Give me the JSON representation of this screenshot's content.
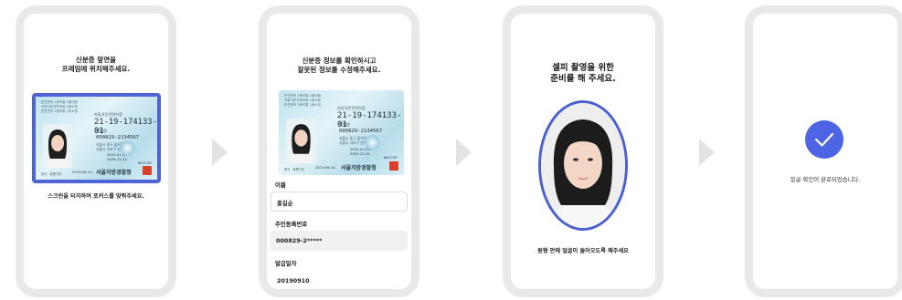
{
  "colors": {
    "accent": "#4d63d6",
    "frame": "#e9e9e9",
    "arrow": "#e3e3e3"
  },
  "screen1": {
    "title": "신분증 앞면을\n프레임에 위치해주세요.",
    "caption": "스크린을 터치하여 포커스를 맞춰주세요."
  },
  "screen2": {
    "title": "신분증 정보를 확인하시고\n잘못된 정보를 수정해주세요.",
    "fields": [
      {
        "label": "이름",
        "value": "홍길순"
      },
      {
        "label": "주민등록번호",
        "value": "000829-2*****"
      },
      {
        "label": "발급일자",
        "value": "20190910"
      }
    ]
  },
  "screen3": {
    "title": "셀피 촬영을 위한\n준비를 해 주세요.",
    "caption": "원형 안에 얼굴이 들어오도록 해주세요"
  },
  "screen4": {
    "message": "얼굴 확인이 완료되었습니다.",
    "icon": "check-icon"
  },
  "id_card": {
    "header": "운전면허 1종보통 1종대형\n자동차운전면허증 2종소형\n운전면허 2종보통 1종소형",
    "license_title": "자동차운전면허증",
    "license_subtitle": "(Driver's License)",
    "number": "21-19-174133-01",
    "name": "홍길순",
    "rrn": "000829-2134567",
    "address": "서울시 중구 을지로\n서울시 서초구 반포",
    "issue_line": "2019.09.10.",
    "dates": "2025.01.01.\n2025.12.31.",
    "code": "6K1C3P",
    "authority": "서울지방경찰청",
    "footer_tag": "형식 · 발행기관",
    "issue_date_short": "2019.09.10."
  }
}
